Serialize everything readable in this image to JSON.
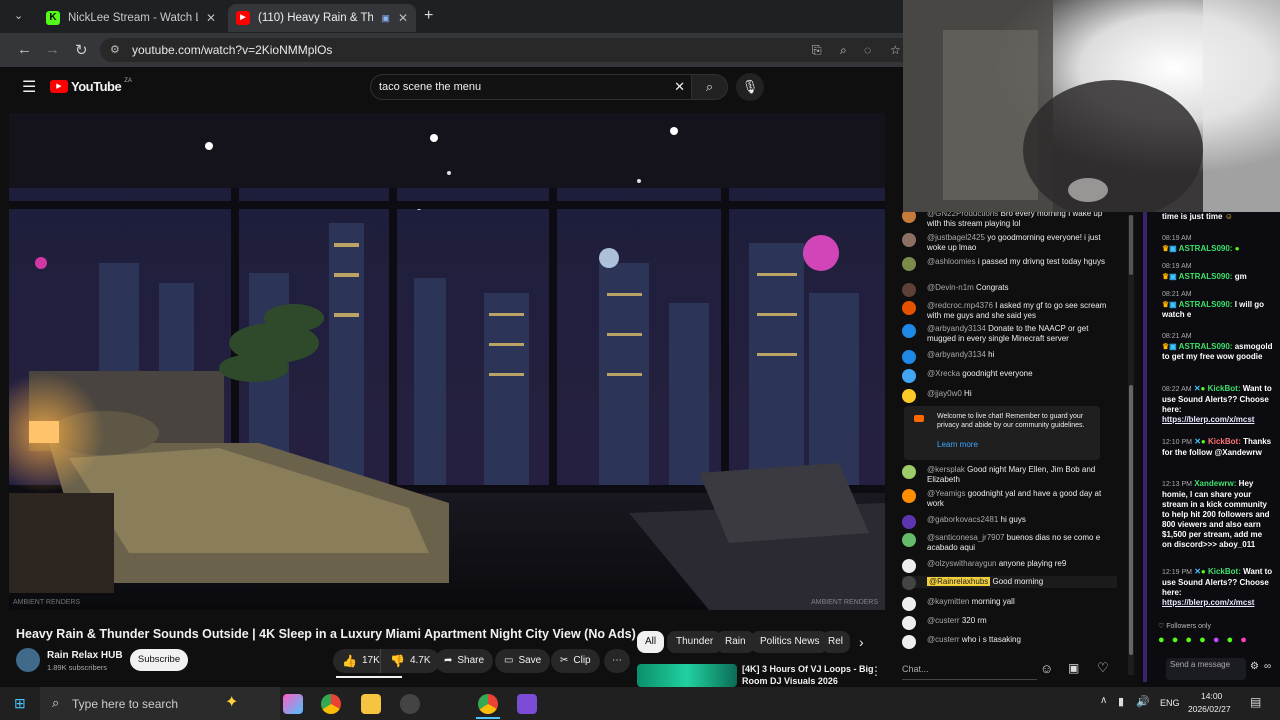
{
  "browser": {
    "tabs": [
      {
        "label": "NickLee Stream - Watch Live on",
        "active": false
      },
      {
        "label": "(110) Heavy Rain & Thunde",
        "active": true
      }
    ],
    "url": "youtube.com/watch?v=2KioNMMplOs"
  },
  "youtube": {
    "logo": "YouTube",
    "region": "ZA",
    "search_value": "taco scene the menu",
    "video_title": "Heavy Rain & Thunder Sounds Outside | 4K Sleep in a Luxury Miami Apartment Night City View (No Ads)",
    "watermark_left": "AMBIENT RENDERS",
    "watermark_right": "AMBIENT RENDERS",
    "channel": {
      "name": "Rain Relax HUB",
      "subscribers": "1.89K subscribers",
      "subscribe_label": "Subscribe"
    },
    "actions": {
      "likes": "17K",
      "dislikes": "4.7K",
      "share": "Share",
      "save": "Save",
      "clip": "Clip"
    },
    "chips": [
      "All",
      "Thunder",
      "Rain",
      "Politics News",
      "Rel"
    ],
    "recommended": {
      "title_line1": "[4K] 3 Hours Of VJ Loops - Big",
      "title_line2": "Room DJ Visuals 2026"
    }
  },
  "live_chat": {
    "messages": [
      {
        "author": "@GN22Productions",
        "text": "Bro every morning I wake up with this stream playing lol",
        "color": "#c77b3a"
      },
      {
        "author": "@justbagel2425",
        "text": "yo goodmorning everyone! i just woke up lmao",
        "color": "#8d6e63"
      },
      {
        "author": "@ashloomies",
        "text": "i passed my drivng test today hguys",
        "color": "#7c8b4a"
      },
      {
        "author": "@Devin-n1m",
        "text": "Congrats",
        "color": "#5d4037"
      },
      {
        "author": "@redcroc.mp4376",
        "text": "I asked my gf to go see scream with me guys and she said yes",
        "color": "#e65100"
      },
      {
        "author": "@arbyandy3134",
        "text": "Donate to the NAACP or get mugged in every single Minecraft server",
        "color": "#1e88e5"
      },
      {
        "author": "@arbyandy3134",
        "text": "hi",
        "color": "#1e88e5"
      },
      {
        "author": "@Xrecka",
        "text": "goodnight everyone",
        "color": "#42a5f5"
      },
      {
        "author": "@jjay0w0",
        "text": "Hi",
        "color": "#ffca28"
      },
      {
        "author": "@kersplak",
        "text": "Good night Mary Ellen, Jim Bob and Elizabeth",
        "color": "#9ccc65"
      },
      {
        "author": "@Yeamigs",
        "text": "goodnight yal and have a good day at work",
        "color": "#ff8f00"
      },
      {
        "author": "@gaborkovacs2481",
        "text": "hi guys",
        "color": "#5e35b1"
      },
      {
        "author": "@santiconesa_jr7907",
        "text": "buenos dias no se como e acabado aqui",
        "color": "#66bb6a"
      },
      {
        "author": "@olzyswitharaygun",
        "text": "anyone playing re9",
        "color": "#eeeeee"
      },
      {
        "author": "@Rainrelaxhubs",
        "text": "Good morning",
        "color": "#444444"
      },
      {
        "author": "@kaymitten",
        "text": "morning yall",
        "color": "#eeeeee"
      },
      {
        "author": "@custerr",
        "text": "320 rm",
        "color": "#eeeeee"
      },
      {
        "author": "@custerr",
        "text": "who i s ttasaking",
        "color": "#eeeeee"
      }
    ],
    "notice_line1": "Welcome to live chat! Remember to guard your",
    "notice_line2": "privacy and abide by our community guidelines.",
    "notice_link": "Learn more",
    "input_placeholder": "Chat..."
  },
  "kick_chat": {
    "top_text": "time is just time",
    "messages": [
      {
        "time": "08:19 AM",
        "user": "ASTRALS090:",
        "text": ""
      },
      {
        "time": "08:19 AM",
        "user": "ASTRALS090:",
        "text": "gm"
      },
      {
        "time": "08:21 AM",
        "user": "ASTRALS090:",
        "text": "I will go watch e"
      },
      {
        "time": "08:21 AM",
        "user": "ASTRALS090:",
        "text": "asmogold to get my free wow goodie"
      },
      {
        "time": "08:22 AM",
        "user": "KickBot:",
        "text": "Want to use Sound Alerts?? Choose here:",
        "link": "https://blerp.com/x/mcst"
      },
      {
        "time": "12:10 PM",
        "user": "KickBot:",
        "text": "Thanks for the follow @Xandewrw"
      },
      {
        "time": "12:13 PM",
        "user": "Xandewrw:",
        "text": "Hey homie, I can share your stream in a kick community to help hit 200 followers and 800 viewers and also earn $1,500 per stream, add me on discord>>> aboy_011"
      },
      {
        "time": "12:19 PM",
        "user": "KickBot:",
        "text": "Want to use Sound Alerts?? Choose here:",
        "link": "https://blerp.com/x/mcst"
      }
    ],
    "followers_only": "Followers only",
    "send_label": "Send a message"
  },
  "taskbar": {
    "search_placeholder": "Type here to search",
    "language": "ENG",
    "time": "14:00",
    "date": "2026/02/27"
  }
}
